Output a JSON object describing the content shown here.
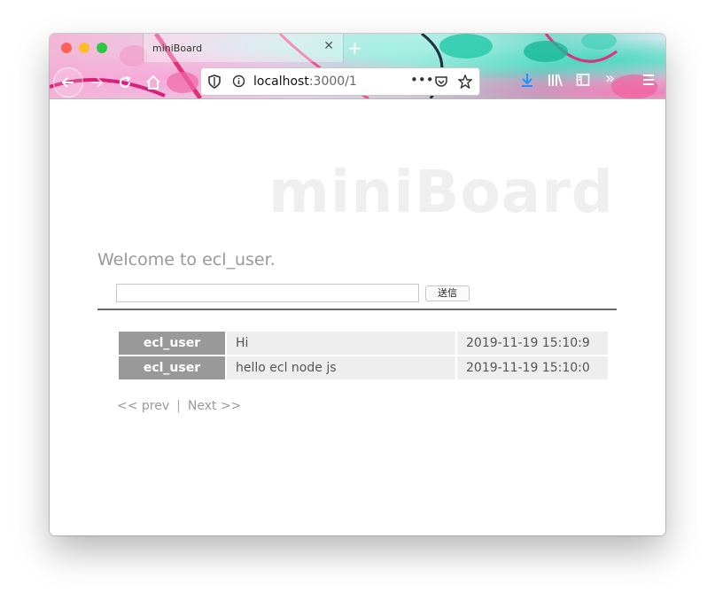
{
  "browser": {
    "tab_title": "miniBoard",
    "url_host": "localhost",
    "url_path": ":3000/1"
  },
  "page": {
    "brand": "miniBoard",
    "welcome": "Welcome to ecl_user.",
    "input_value": "",
    "send_label": "送信",
    "messages": [
      {
        "user": "ecl_user",
        "text": "Hi",
        "time": "2019-11-19 15:10:9"
      },
      {
        "user": "ecl_user",
        "text": "hello ecl node js",
        "time": "2019-11-19 15:10:0"
      }
    ],
    "pager": {
      "prev": "<< prev",
      "sep": "|",
      "next": "Next >>"
    }
  },
  "icons": [
    "back-arrow-icon",
    "forward-arrow-icon",
    "reload-icon",
    "home-icon",
    "shield-icon",
    "info-icon",
    "more-icon",
    "pocket-icon",
    "star-icon",
    "download-icon",
    "library-icon",
    "sidebar-icon",
    "overflow-icon",
    "menu-icon",
    "close-icon",
    "plus-icon"
  ]
}
